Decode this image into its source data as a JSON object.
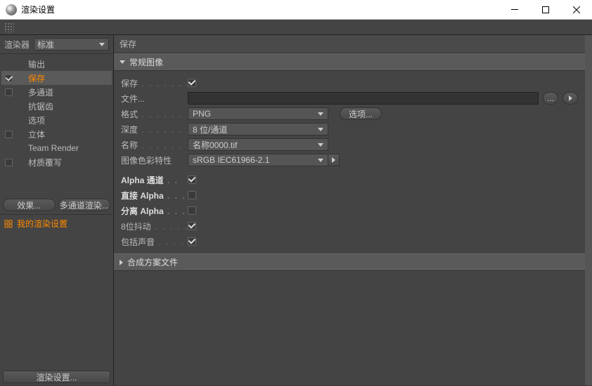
{
  "titlebar": {
    "title": "渲染设置"
  },
  "renderer": {
    "label": "渲染器",
    "value": "标准"
  },
  "sidebar": {
    "items": [
      {
        "label": "输出",
        "checked": false,
        "hasCheck": false
      },
      {
        "label": "保存",
        "checked": true,
        "hasCheck": true,
        "active": true
      },
      {
        "label": "多通道",
        "checked": false,
        "hasCheck": true
      },
      {
        "label": "抗锯齿",
        "checked": false,
        "hasCheck": false
      },
      {
        "label": "选项",
        "checked": false,
        "hasCheck": false
      },
      {
        "label": "立体",
        "checked": false,
        "hasCheck": true
      },
      {
        "label": "Team Render",
        "checked": false,
        "hasCheck": false
      },
      {
        "label": "材质覆写",
        "checked": false,
        "hasCheck": true
      }
    ],
    "effects_btn": "效果...",
    "multipass_btn": "多通道渲染...",
    "preset": "我的渲染设置",
    "footer_btn": "渲染设置..."
  },
  "content": {
    "header": "保存",
    "panel1": "常规图像",
    "panel2": "合成方案文件",
    "save": {
      "label": "保存",
      "checked": true
    },
    "file": {
      "label": "文件...",
      "value": ""
    },
    "format": {
      "label": "格式",
      "value": "PNG",
      "options_btn": "选项..."
    },
    "depth": {
      "label": "深度",
      "value": "8 位/通道"
    },
    "name": {
      "label": "名称",
      "value": "名称0000.tif"
    },
    "colorprofile": {
      "label": "图像色彩特性",
      "value": "sRGB IEC61966-2.1"
    },
    "alpha": {
      "label": "Alpha 通道",
      "checked": true
    },
    "straight_alpha": {
      "label": "直接 Alpha",
      "checked": false
    },
    "separate_alpha": {
      "label": "分离 Alpha",
      "checked": false
    },
    "dither": {
      "label": "8位抖动",
      "checked": true
    },
    "sound": {
      "label": "包括声音",
      "checked": true
    }
  }
}
